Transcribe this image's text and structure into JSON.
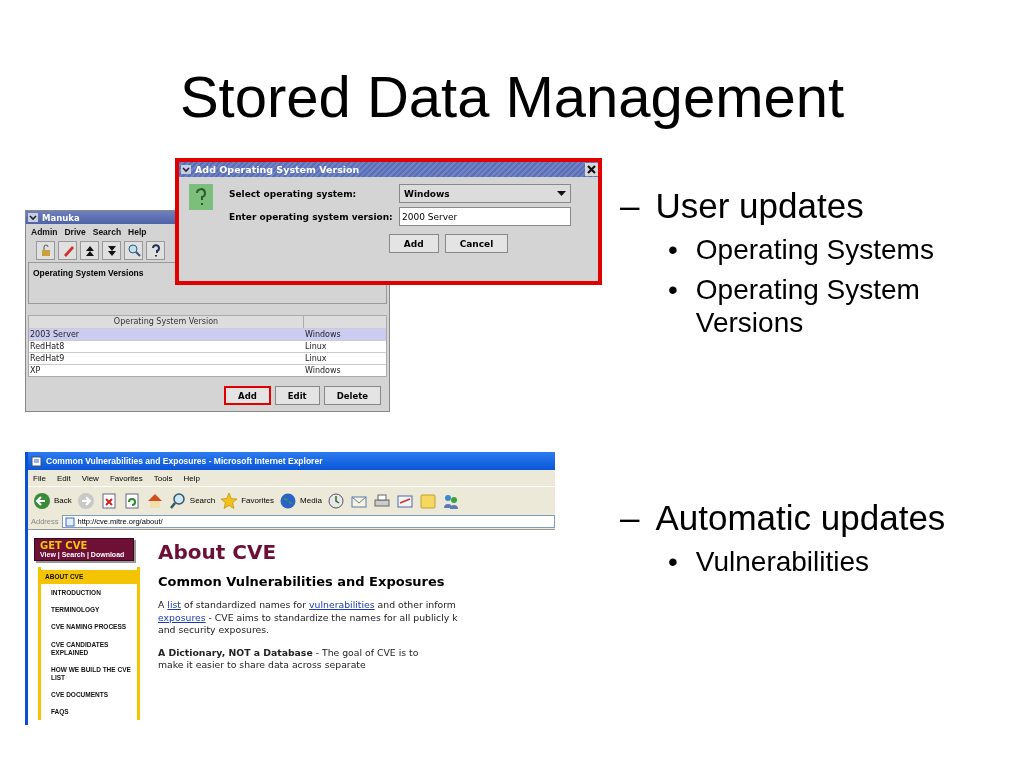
{
  "title": "Stored Data Management",
  "manuka": {
    "title": "Manuka",
    "menu": [
      "Admin",
      "Drive",
      "Search",
      "Help"
    ],
    "panel_title": "Operating System Versions",
    "table": {
      "columns": [
        "Operating System Version"
      ],
      "rows": [
        {
          "cells": [
            "2003 Server",
            "Windows"
          ],
          "selected": true
        },
        {
          "cells": [
            "RedHat8",
            "Linux"
          ],
          "selected": false
        },
        {
          "cells": [
            "RedHat9",
            "Linux"
          ],
          "selected": false
        },
        {
          "cells": [
            "XP",
            "Windows"
          ],
          "selected": false
        }
      ]
    },
    "buttons": [
      {
        "label": "Add",
        "highlighted": true
      },
      {
        "label": "Edit",
        "highlighted": false
      },
      {
        "label": "Delete",
        "highlighted": false
      }
    ]
  },
  "dialog": {
    "title": "Add Operating System Version",
    "highlighted": true,
    "fields": [
      {
        "kind": "select",
        "label": "Select operating system:",
        "value": "Windows"
      },
      {
        "kind": "text",
        "label": "Enter operating system version:",
        "value": "2000 Server"
      }
    ],
    "buttons": [
      "Add",
      "Cancel"
    ]
  },
  "bullets": [
    {
      "marker": "–",
      "text": "User updates",
      "children": [
        {
          "marker": "•",
          "text": "Operating Systems"
        },
        {
          "marker": "•",
          "text": "Operating System Versions"
        }
      ]
    },
    {
      "marker": "–",
      "text": "Automatic updates",
      "children": [
        {
          "marker": "•",
          "text": "Vulnerabilities"
        }
      ]
    }
  ],
  "browser": {
    "title": "Common Vulnerabilities and Exposures - Microsoft Internet Explorer",
    "menu": [
      "File",
      "Edit",
      "View",
      "Favorites",
      "Tools",
      "Help"
    ],
    "toolbar": [
      {
        "kind": "back",
        "label": "Back"
      },
      {
        "kind": "forward"
      },
      {
        "kind": "stop"
      },
      {
        "kind": "refresh"
      },
      {
        "kind": "home"
      },
      {
        "kind": "search",
        "label": "Search"
      },
      {
        "kind": "favorites",
        "label": "Favorites"
      },
      {
        "kind": "media",
        "label": "Media"
      },
      {
        "kind": "history"
      },
      {
        "kind": "mail"
      },
      {
        "kind": "print"
      },
      {
        "kind": "edit"
      },
      {
        "kind": "notes"
      },
      {
        "kind": "messenger"
      }
    ],
    "address_label": "Address",
    "url": "http://cve.mitre.org/about/",
    "get_cve": {
      "title": "GET CVE",
      "subtitle": "View | Search | Download"
    },
    "nav": [
      {
        "label": "ABOUT CVE",
        "selected": true
      },
      {
        "label": "INTRODUCTION",
        "selected": false
      },
      {
        "label": "TERMINOLOGY",
        "selected": false
      },
      {
        "label": "CVE NAMING PROCESS",
        "selected": false
      },
      {
        "label": "CVE CANDIDATES EXPLAINED",
        "selected": false
      },
      {
        "label": "HOW WE BUILD THE CVE LIST",
        "selected": false
      },
      {
        "label": "CVE DOCUMENTS",
        "selected": false
      },
      {
        "label": "FAQS",
        "selected": false
      }
    ],
    "heading": "About CVE",
    "subheading": "Common Vulnerabilities and Exposures",
    "intro_lines": [
      [
        {
          "text": "A "
        },
        {
          "text": "list",
          "link": true
        },
        {
          "text": " of standardized names for "
        },
        {
          "text": "vulnerabilities",
          "link": true
        },
        {
          "text": " and other inform"
        }
      ],
      [
        {
          "text": "exposures",
          "link": true
        },
        {
          "text": " - CVE aims to standardize the names for all publicly k"
        }
      ],
      [
        {
          "text": "and security exposures."
        }
      ]
    ],
    "dictionary_lines": [
      "**A Dictionary, NOT a Database** - The goal of CVE is to",
      "make it easier to share data across separate"
    ]
  }
}
